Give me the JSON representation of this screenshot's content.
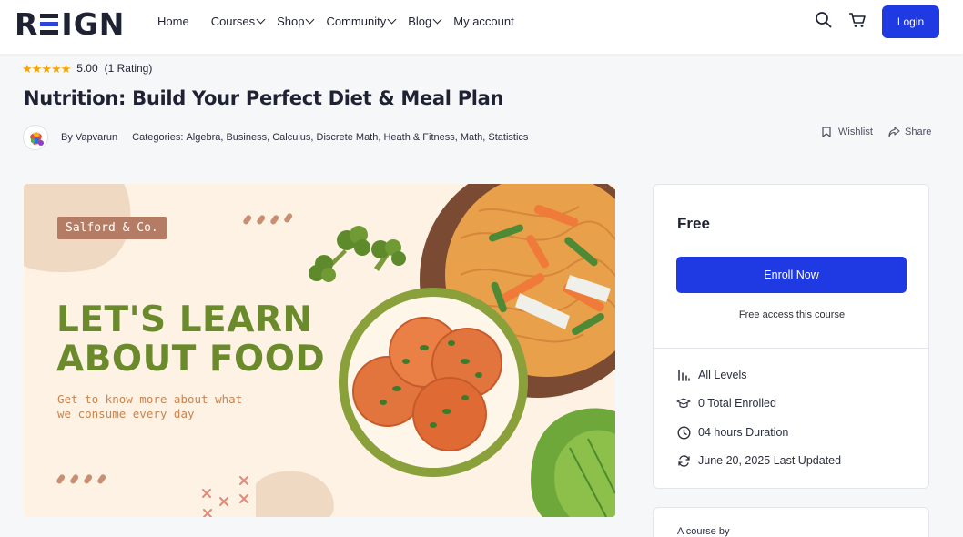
{
  "header": {
    "logo_left": "R",
    "logo_right": "IGN",
    "nav": [
      {
        "label": "Home",
        "has_dropdown": false
      },
      {
        "label": "Courses",
        "has_dropdown": true
      },
      {
        "label": "Shop",
        "has_dropdown": true
      },
      {
        "label": "Community",
        "has_dropdown": true
      },
      {
        "label": "Blog",
        "has_dropdown": true
      },
      {
        "label": "My account",
        "has_dropdown": false
      }
    ],
    "login_label": "Login",
    "accent_color": "#1f3ae3"
  },
  "course": {
    "rating_value": "5.00",
    "rating_count": "(1 Rating)",
    "title": "Nutrition: Build Your Perfect Diet & Meal Plan",
    "author": "By Vapvarun",
    "categories_label": "Categories:",
    "categories": "Algebra, Business, Calculus, Discrete Math, Heath & Fitness, Math, Statistics",
    "wishlist_label": "Wishlist",
    "share_label": "Share"
  },
  "banner": {
    "tag": "Salford & Co.",
    "headline_line1": "LET'S LEARN",
    "headline_line2": "ABOUT FOOD",
    "sub_line1": "Get to know more about what",
    "sub_line2": "we consume every day"
  },
  "sidebar": {
    "price": "Free",
    "enroll_label": "Enroll Now",
    "free_note": "Free access this course",
    "info": {
      "level": "All Levels",
      "enrolled": "0 Total Enrolled",
      "duration": "04 hours  Duration",
      "updated": "June 20, 2025 Last Updated"
    },
    "course_by_label": "A course by"
  }
}
